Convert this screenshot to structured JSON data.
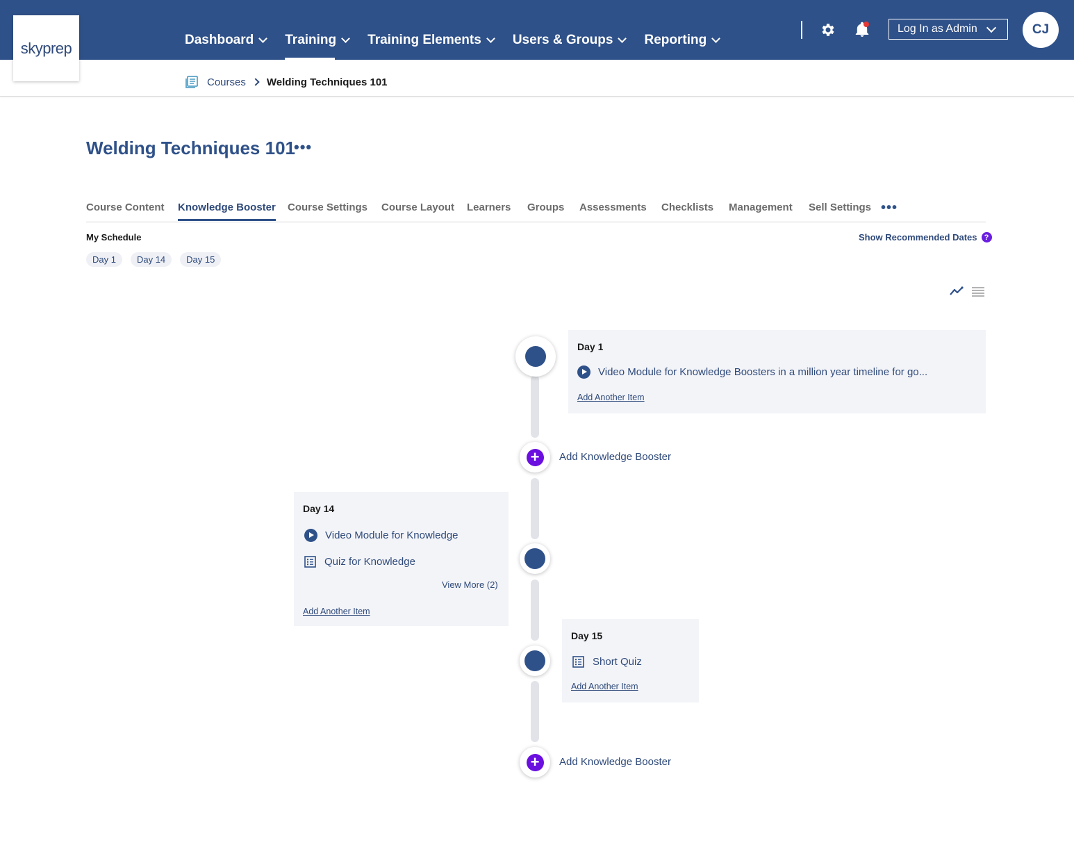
{
  "logo": {
    "text": "skyprep"
  },
  "nav": {
    "items": [
      {
        "label": "Dashboard"
      },
      {
        "label": "Training"
      },
      {
        "label": "Training Elements"
      },
      {
        "label": "Users & Groups"
      },
      {
        "label": "Reporting"
      }
    ],
    "active": "Training"
  },
  "header": {
    "admin_select": "Log In as Admin",
    "avatar_initials": "CJ",
    "notification_dot_color": "#e53935"
  },
  "breadcrumb": {
    "parent": "Courses",
    "current": "Welding Techniques 101"
  },
  "page": {
    "title": "Welding Techniques 101",
    "more": "•••"
  },
  "tabs": {
    "items": [
      {
        "label": "Course Content"
      },
      {
        "label": "Knowledge Booster"
      },
      {
        "label": "Course Settings"
      },
      {
        "label": "Course Layout"
      },
      {
        "label": "Learners"
      },
      {
        "label": "Groups"
      },
      {
        "label": "Assessments"
      },
      {
        "label": "Checklists"
      },
      {
        "label": "Management"
      },
      {
        "label": "Sell Settings"
      }
    ],
    "active": "Knowledge Booster",
    "more": "•••"
  },
  "schedule": {
    "label": "My Schedule",
    "chips": [
      "Day 1",
      "Day 14",
      "Day 15"
    ],
    "show_recommended": "Show Recommended Dates",
    "help": "?"
  },
  "timeline": {
    "add_booster_label": "Add Knowledge Booster",
    "add_item_label": "Add Another Item",
    "cards": [
      {
        "title": "Day 1",
        "items": [
          {
            "type": "video",
            "label": "Video Module for Knowledge Boosters in a million year timeline for go..."
          }
        ]
      },
      {
        "title": "Day 14",
        "items": [
          {
            "type": "video",
            "label": "Video Module for Knowledge"
          },
          {
            "type": "quiz",
            "label": "Quiz for Knowledge"
          }
        ],
        "view_more": "View More (2)"
      },
      {
        "title": "Day 15",
        "items": [
          {
            "type": "quiz",
            "label": "Short Quiz"
          }
        ]
      }
    ]
  },
  "colors": {
    "brand": "#2f5189",
    "accent_purple": "#6a0fe0",
    "card_bg": "#f3f4f8"
  }
}
